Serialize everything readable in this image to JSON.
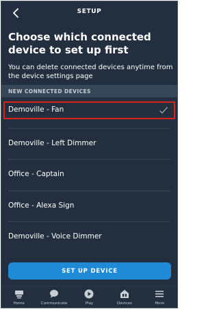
{
  "header": {
    "title": "SETUP",
    "back_icon": "chevron-left-icon"
  },
  "heading": "Choose which connected device to set up first",
  "subtext": "You can delete connected devices anytime from the device settings page",
  "section_label": "NEW CONNECTED DEVICES",
  "devices": [
    {
      "label": "Demoville - Fan",
      "selected": true
    },
    {
      "label": "Demoville - Left Dimmer",
      "selected": false
    },
    {
      "label": "Office - Captain",
      "selected": false
    },
    {
      "label": "Office - Alexa Sign",
      "selected": false
    },
    {
      "label": "Demoville - Voice Dimmer",
      "selected": false
    }
  ],
  "primary_button": "SET UP DEVICE",
  "tabs": [
    {
      "label": "Home",
      "icon": "home-icon"
    },
    {
      "label": "Communicate",
      "icon": "chat-bubble-icon"
    },
    {
      "label": "Play",
      "icon": "play-icon"
    },
    {
      "label": "Devices",
      "icon": "devices-icon"
    },
    {
      "label": "More",
      "icon": "menu-icon"
    }
  ],
  "colors": {
    "background": "#232f3e",
    "section_band": "#37475a",
    "accent": "#1f8ad6",
    "selection_outline": "#d9231b"
  }
}
